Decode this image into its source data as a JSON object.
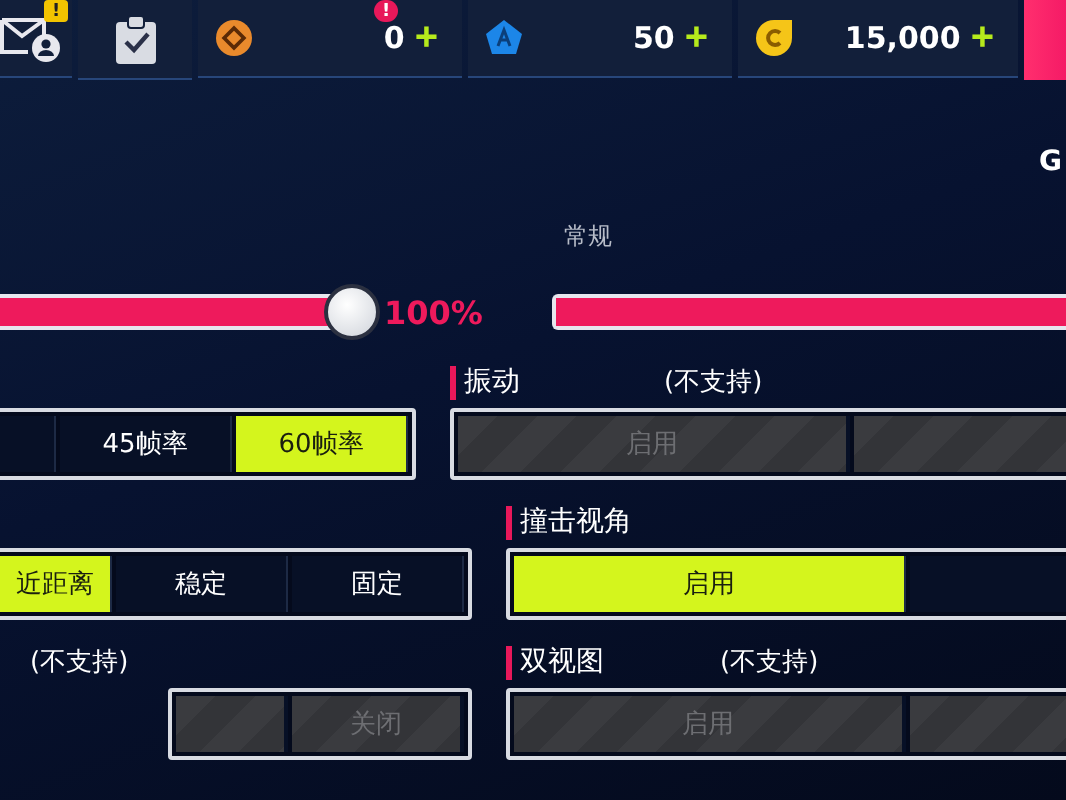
{
  "top_bar": {
    "mail_badge": "!",
    "currencies": [
      {
        "kind": "gem",
        "amount": "0",
        "add": "+",
        "badge": "!"
      },
      {
        "kind": "pentagon",
        "amount": "50",
        "add": "+"
      },
      {
        "kind": "coin",
        "amount": "15,000",
        "add": "+"
      }
    ]
  },
  "corner_text": "G",
  "section_title": "常规",
  "sliders": [
    {
      "level": 1,
      "reading": "100%"
    },
    {
      "level": 1
    }
  ],
  "rows": [
    {
      "right": {
        "kind": "heading",
        "title": "振动",
        "note": "(不支持)"
      }
    },
    {
      "left": {
        "kind": "segmented",
        "disabled": false,
        "options": [
          {
            "selected": false
          },
          {
            "label": "45帧率",
            "selected": false
          },
          {
            "label": "60帧率",
            "selected": true
          }
        ]
      },
      "right": {
        "kind": "segmented",
        "disabled": true,
        "options": [
          {
            "kind": "text",
            "label": "启用"
          },
          {
            "kind": "blank"
          }
        ]
      }
    },
    {
      "right": {
        "kind": "heading",
        "title": "撞击视角"
      }
    },
    {
      "left": {
        "kind": "segmented",
        "disabled": false,
        "options": [
          {
            "label": "近距离",
            "selected": true
          },
          {
            "label": "稳定",
            "selected": false
          },
          {
            "label": "固定",
            "selected": false
          }
        ]
      },
      "right": {
        "kind": "segmented",
        "disabled": false,
        "options": [
          {
            "label": "启用",
            "selected": true
          },
          {
            "selected": false
          }
        ]
      }
    },
    {
      "left": {
        "kind": "heading",
        "note": "(不支持)"
      },
      "right": {
        "kind": "heading",
        "title": "双视图",
        "note": "(不支持)"
      }
    },
    {
      "left": {
        "kind": "segmented",
        "disabled": true,
        "options": [
          {
            "kind": "blank"
          },
          {
            "kind": "text",
            "label": "关闭"
          }
        ]
      },
      "right": {
        "kind": "segmented",
        "disabled": true,
        "options": [
          {
            "kind": "text",
            "label": "启用"
          },
          {
            "kind": "blank"
          }
        ]
      }
    }
  ]
}
